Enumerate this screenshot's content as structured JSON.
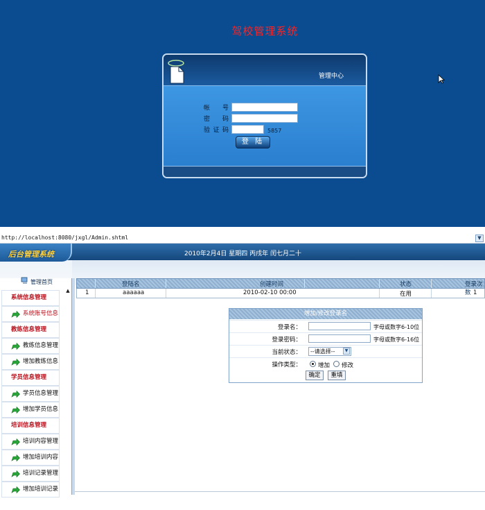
{
  "login": {
    "system_title": "驾校管理系统",
    "panel_caption": "管理中心",
    "account_label": "帐 号",
    "password_label": "密 码",
    "captcha_label": "验证码",
    "captcha_code": "5857",
    "login_button": "登 陆",
    "background_color": "#0a4c8f"
  },
  "browser": {
    "address": "http://localhost:8080/jxgl/Admin.shtml"
  },
  "admin": {
    "header": {
      "logo_text": "后台管理系统",
      "date_text": "2010年2月4日 星期四 丙戌年 闰七月二十"
    },
    "sidebar": {
      "home_label": "管理首页",
      "items": [
        {
          "label": "系统信息管理",
          "type": "heading"
        },
        {
          "label": "系统账号信息",
          "type": "item"
        },
        {
          "label": "教练信息管理",
          "type": "heading"
        },
        {
          "label": "教练信息管理",
          "type": "item"
        },
        {
          "label": "增加教练信息",
          "type": "item"
        },
        {
          "label": "学员信息管理",
          "type": "heading"
        },
        {
          "label": "学员信息管理",
          "type": "item"
        },
        {
          "label": "增加学员信息",
          "type": "item"
        },
        {
          "label": "培训信息管理",
          "type": "heading"
        },
        {
          "label": "培训内容管理",
          "type": "item"
        },
        {
          "label": "增加培训内容",
          "type": "item"
        },
        {
          "label": "培训记录管理",
          "type": "item"
        },
        {
          "label": "增加培训记录",
          "type": "item"
        }
      ]
    },
    "table": {
      "columns": [
        "登陆名",
        "创建时间",
        "状态",
        "登录次数"
      ],
      "rows": [
        {
          "index": "1",
          "login_name": "aaaaaa",
          "created": "2010-02-10 00:00",
          "status": "在用",
          "login_count": "1"
        }
      ]
    },
    "form": {
      "title": "增加/修改登录名",
      "login_name_label": "登录名：",
      "login_name_hint": "字母或数字6-10位",
      "password_label": "登录密码：",
      "password_hint": "字母或数字6-16位",
      "status_label": "当前状态：",
      "status_selected": "--请选择--",
      "op_label": "操作类型：",
      "op_add": "增加",
      "op_edit": "修改",
      "ok_button": "确定",
      "reset_button": "重填"
    }
  }
}
